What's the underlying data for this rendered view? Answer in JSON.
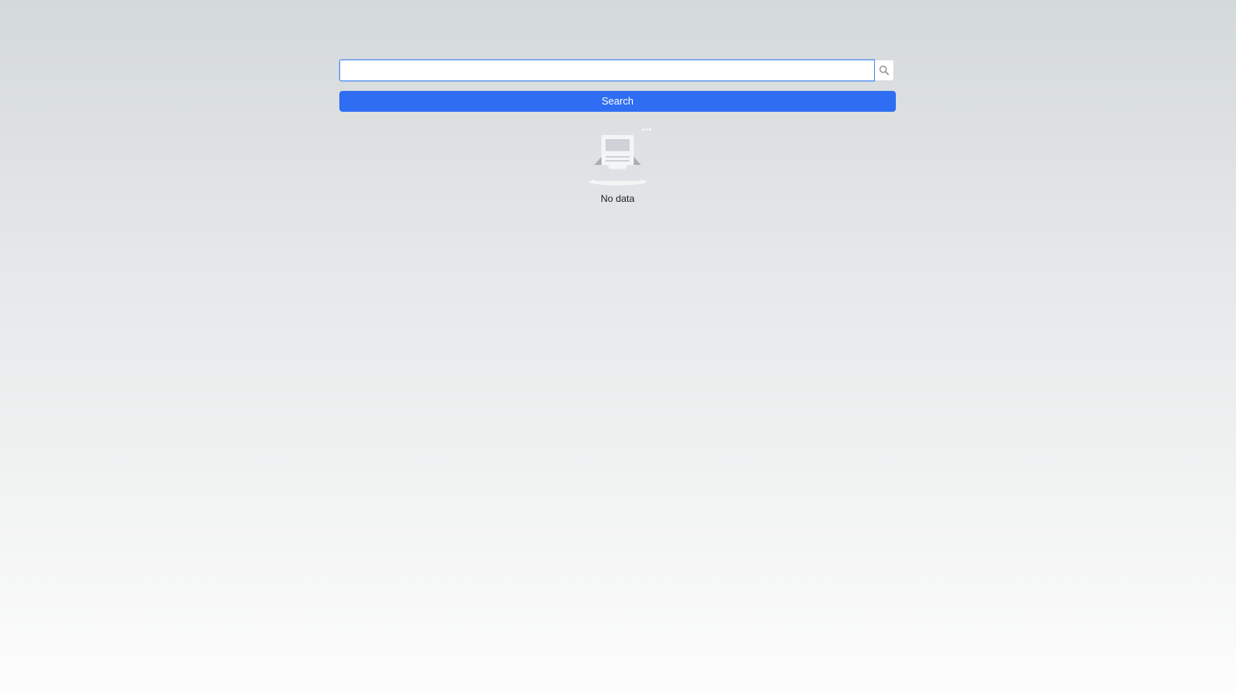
{
  "search": {
    "value": "",
    "placeholder": "",
    "button_label": "Search",
    "icon": "search-icon"
  },
  "empty_state": {
    "icon": "empty-inbox-icon",
    "text": "No data"
  },
  "colors": {
    "accent": "#2f6ef3",
    "focus_border": "#4a8cf0"
  }
}
